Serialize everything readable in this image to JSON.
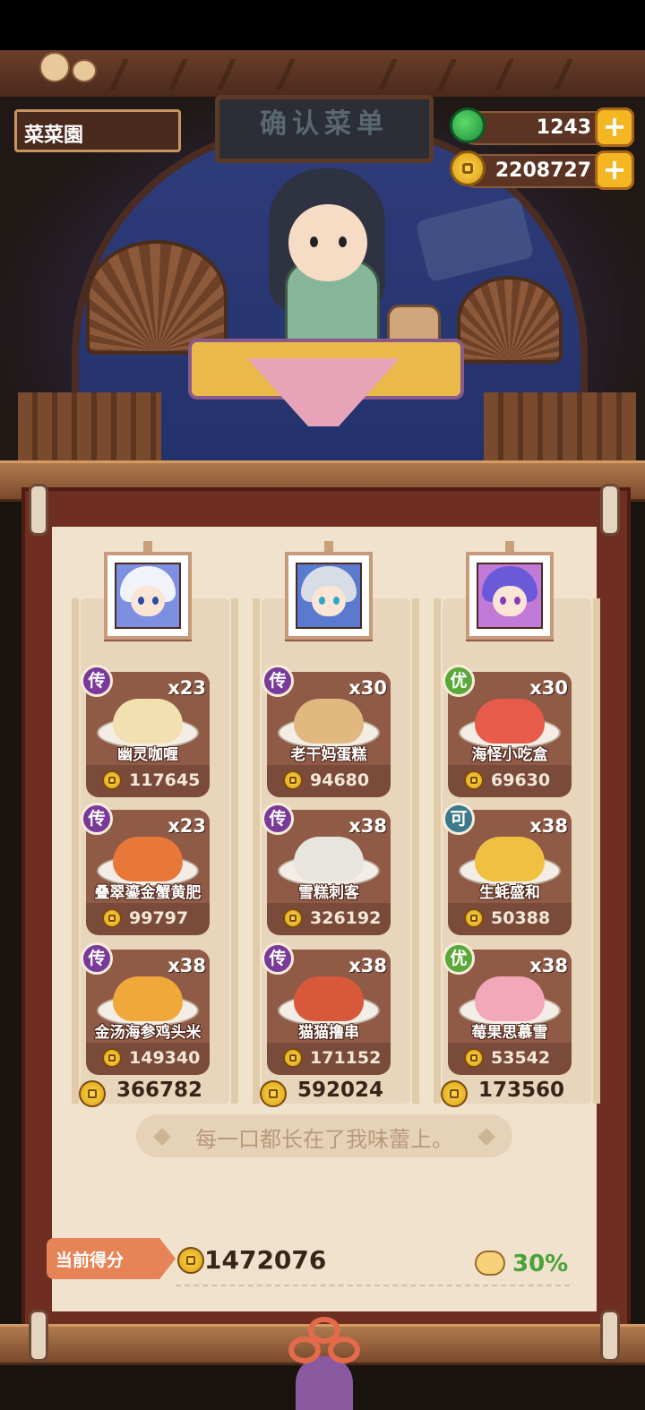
{
  "header": {
    "restaurant_name": "菜菜園",
    "sign_text": "确认菜单",
    "currencies": [
      {
        "icon": "jade-icon",
        "value": "1243"
      },
      {
        "icon": "coin-icon",
        "value": "2208727"
      }
    ]
  },
  "columns": [
    {
      "character": "white-hair-character",
      "dishes": [
        {
          "badge": "传",
          "badge_color": "#7a3a9a",
          "qty": "x23",
          "name": "幽灵咖喱",
          "price": "117645",
          "food_color": "#f2e0b0"
        },
        {
          "badge": "传",
          "badge_color": "#7a3a9a",
          "qty": "x23",
          "name": "叠翠鎏金蟹黄肥",
          "price": "99797",
          "food_color": "#e8783a"
        },
        {
          "badge": "传",
          "badge_color": "#7a3a9a",
          "qty": "x38",
          "name": "金汤海参鸡头米",
          "price": "149340",
          "food_color": "#f0a83a"
        }
      ],
      "total": "366782"
    },
    {
      "character": "silver-hair-character",
      "dishes": [
        {
          "badge": "传",
          "badge_color": "#7a3a9a",
          "qty": "x30",
          "name": "老干妈蛋糕",
          "price": "94680",
          "food_color": "#e0b880"
        },
        {
          "badge": "传",
          "badge_color": "#7a3a9a",
          "qty": "x38",
          "name": "雪糕刺客",
          "price": "326192",
          "food_color": "#e8e4de"
        },
        {
          "badge": "传",
          "badge_color": "#7a3a9a",
          "qty": "x38",
          "name": "猫猫撸串",
          "price": "171152",
          "food_color": "#d8583a"
        }
      ],
      "total": "592024"
    },
    {
      "character": "purple-hair-character",
      "dishes": [
        {
          "badge": "优",
          "badge_color": "#5aa83a",
          "qty": "x30",
          "name": "海怪小吃盒",
          "price": "69630",
          "food_color": "#e85a4a"
        },
        {
          "badge": "可",
          "badge_color": "#3a7a8a",
          "qty": "x38",
          "name": "生蚝盛和",
          "price": "50388",
          "food_color": "#f0c040"
        },
        {
          "badge": "优",
          "badge_color": "#5aa83a",
          "qty": "x38",
          "name": "莓果思慕雪",
          "price": "53542",
          "food_color": "#f2a8b8"
        }
      ],
      "total": "173560"
    }
  ],
  "comment": "每一口都长在了我味蕾上。",
  "score": {
    "label": "当前得分",
    "value": "1472076",
    "percent": "30%"
  },
  "colors": {
    "accent": "#f5b624",
    "scroll_frame": "#6e2e22",
    "paper": "#f0e2cc",
    "card": "#7a4a3a"
  }
}
